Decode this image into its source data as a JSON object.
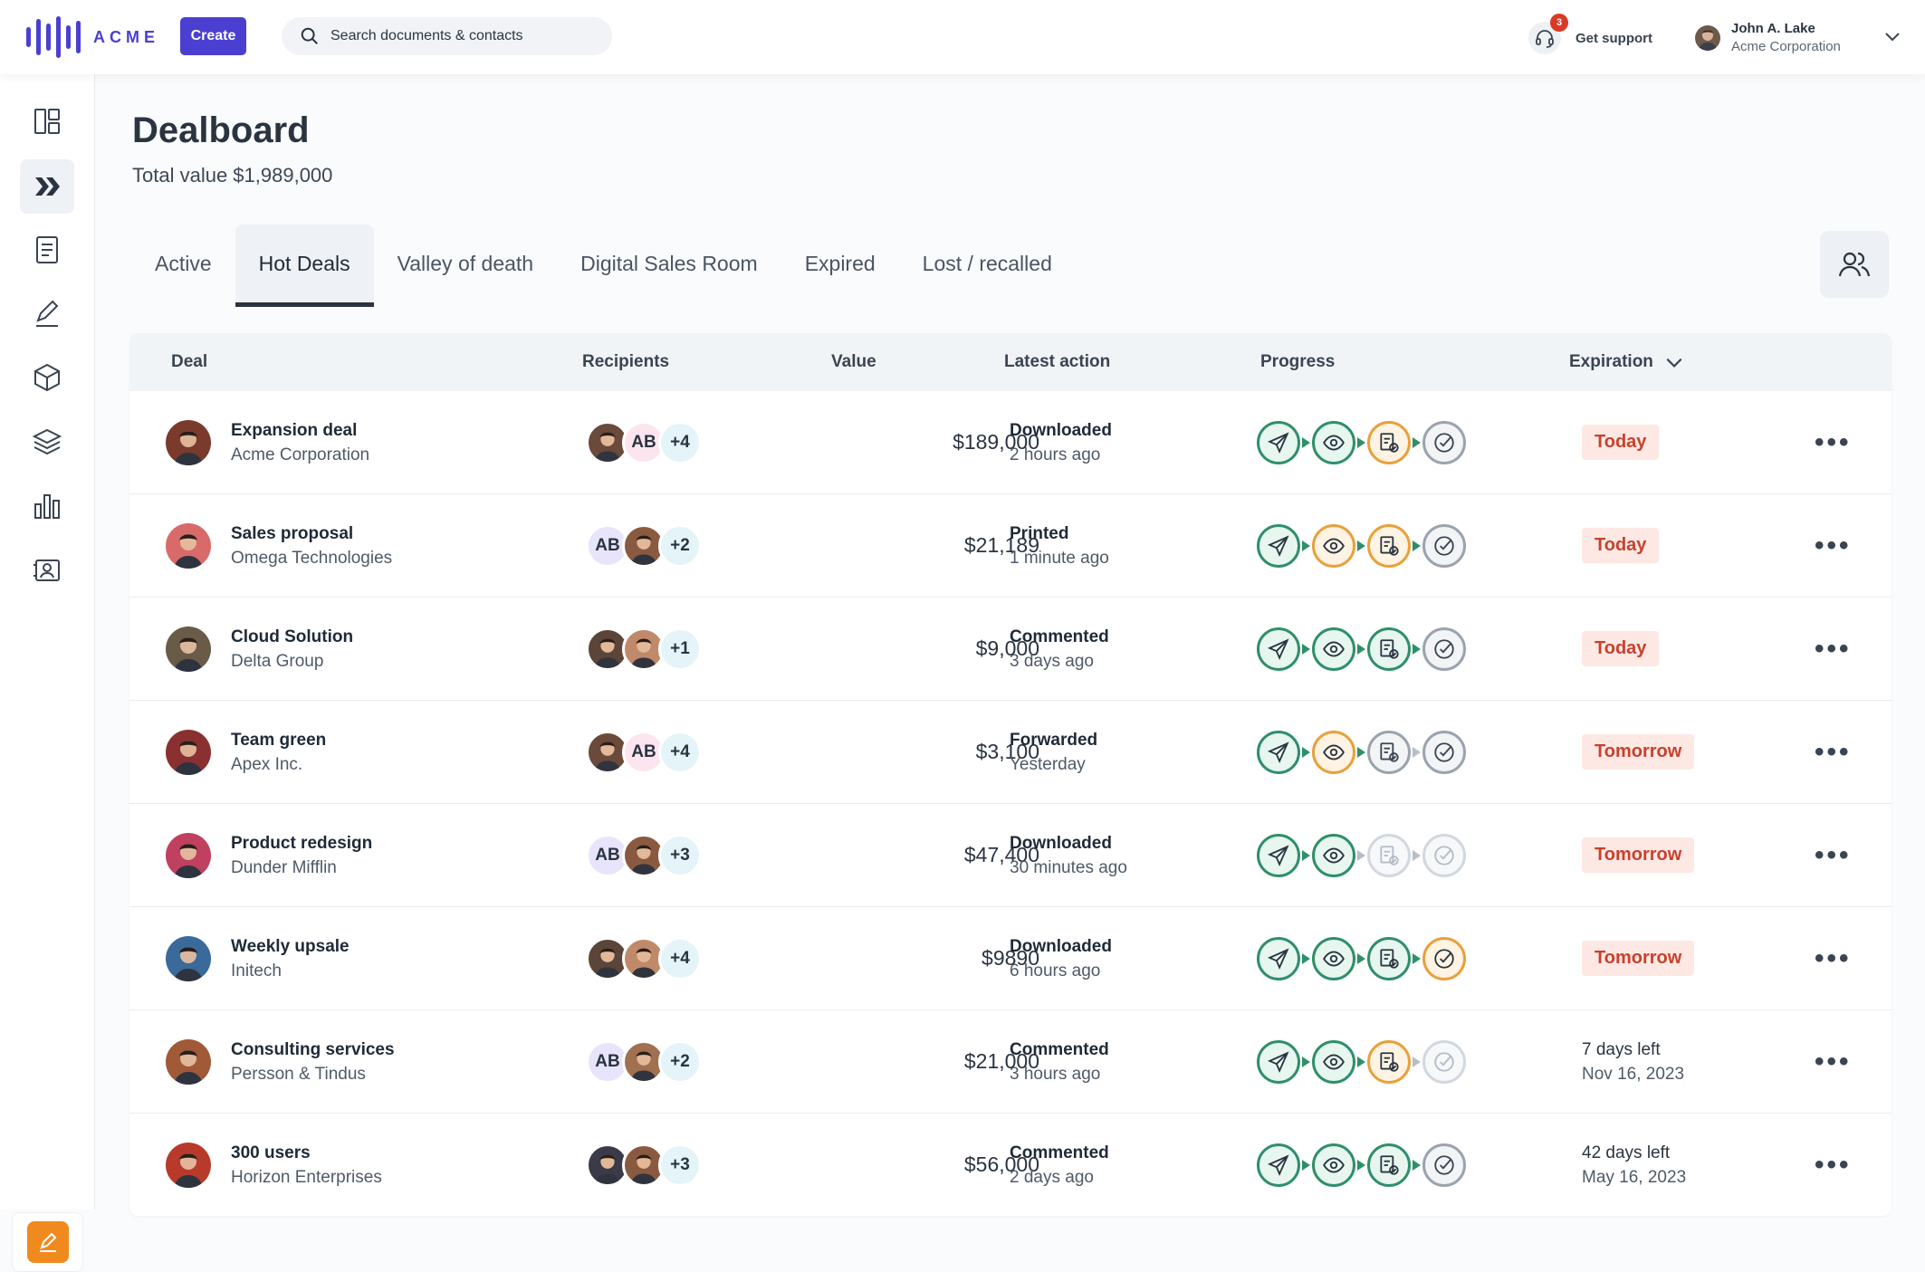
{
  "app": {
    "logo_text": "ACME",
    "create_label": "Create"
  },
  "search": {
    "placeholder": "Search documents & contacts"
  },
  "support": {
    "label": "Get support",
    "badge_count": "3"
  },
  "user": {
    "name": "John A. Lake",
    "org": "Acme Corporation"
  },
  "sidebar": {
    "items": [
      {
        "icon": "dashboard-icon"
      },
      {
        "icon": "dealboard-icon",
        "active": true
      },
      {
        "icon": "documents-icon"
      },
      {
        "icon": "signature-icon"
      },
      {
        "icon": "products-icon"
      },
      {
        "icon": "layers-icon"
      },
      {
        "icon": "analytics-icon"
      },
      {
        "icon": "contacts-icon"
      }
    ],
    "bottom_icon": "sign-pen-icon"
  },
  "page": {
    "title": "Dealboard",
    "total_value": "Total value $1,989,000"
  },
  "tabs": [
    {
      "label": "Active"
    },
    {
      "label": "Hot Deals",
      "active": true
    },
    {
      "label": "Valley of death"
    },
    {
      "label": "Digital Sales Room"
    },
    {
      "label": "Expired"
    },
    {
      "label": "Lost / recalled"
    }
  ],
  "table": {
    "headers": {
      "deal": "Deal",
      "recipients": "Recipients",
      "value": "Value",
      "latest_action": "Latest action",
      "progress": "Progress",
      "expiration": "Expiration"
    },
    "rows": [
      {
        "deal": "Expansion deal",
        "company": "Acme Corporation",
        "recipients": [
          "photo",
          "AB",
          "+4"
        ],
        "value": "$189,000",
        "action": "Downloaded",
        "action_time": "2 hours ago",
        "progress": [
          "green",
          "green",
          "orange",
          "grey"
        ],
        "expiration": "Today",
        "expiration_sub": "",
        "pill": true,
        "avatar_color": "#7a3a2c"
      },
      {
        "deal": "Sales proposal",
        "company": "Omega Technologies",
        "recipients": [
          "AB",
          "photo",
          "+2"
        ],
        "value": "$21,189",
        "action": "Printed",
        "action_time": "1 minute ago",
        "progress": [
          "green",
          "orange",
          "orange",
          "grey"
        ],
        "expiration": "Today",
        "expiration_sub": "",
        "pill": true,
        "avatar_color": "#d96a6a"
      },
      {
        "deal": "Cloud Solution",
        "company": "Delta Group",
        "recipients": [
          "photo",
          "photo",
          "+1"
        ],
        "value": "$9,000",
        "action": "Commented",
        "action_time": "3 days ago",
        "progress": [
          "green",
          "green",
          "green",
          "grey"
        ],
        "expiration": "Today",
        "expiration_sub": "",
        "pill": true,
        "avatar_color": "#6a5a48"
      },
      {
        "deal": "Team green",
        "company": "Apex Inc.",
        "recipients": [
          "photo",
          "AB",
          "+4"
        ],
        "value": "$3,100",
        "action": "Forwarded",
        "action_time": "Yesterday",
        "progress": [
          "green",
          "orange",
          "grey",
          "grey"
        ],
        "expiration": "Tomorrow",
        "expiration_sub": "",
        "pill": true,
        "avatar_color": "#8a3030"
      },
      {
        "deal": "Product redesign",
        "company": "Dunder Mifflin",
        "recipients": [
          "AB",
          "photo",
          "+3"
        ],
        "value": "$47,400",
        "action": "Downloaded",
        "action_time": "30 minutes ago",
        "progress": [
          "green",
          "green",
          "faint",
          "faint"
        ],
        "expiration": "Tomorrow",
        "expiration_sub": "",
        "pill": true,
        "avatar_color": "#c04060"
      },
      {
        "deal": "Weekly upsale",
        "company": "Initech",
        "recipients": [
          "photo",
          "photo",
          "+4"
        ],
        "value": "$9890",
        "action": "Downloaded",
        "action_time": "6 hours ago",
        "progress": [
          "green",
          "green",
          "green",
          "orange"
        ],
        "expiration": "Tomorrow",
        "expiration_sub": "",
        "pill": true,
        "avatar_color": "#3a6a9a"
      },
      {
        "deal": "Consulting services",
        "company": "Persson & Tindus",
        "recipients": [
          "AB",
          "photo",
          "+2"
        ],
        "value": "$21,000",
        "action": "Commented",
        "action_time": "3 hours ago",
        "progress": [
          "green",
          "green",
          "orange",
          "faint"
        ],
        "expiration": "7 days left",
        "expiration_sub": "Nov 16, 2023",
        "pill": false,
        "avatar_color": "#a05a38"
      },
      {
        "deal": "300 users",
        "company": "Horizon Enterprises",
        "recipients": [
          "photo",
          "photo",
          "+3"
        ],
        "value": "$56,000",
        "action": "Commented",
        "action_time": "2 days ago",
        "progress": [
          "green",
          "green",
          "green",
          "grey"
        ],
        "expiration": "42 days left",
        "expiration_sub": "May 16, 2023",
        "pill": false,
        "avatar_color": "#b83a2a"
      }
    ]
  },
  "colors": {
    "brand": "#4b3fd1",
    "progress_green": "#2f8f6b",
    "progress_orange": "#e9a03c",
    "expiry_red": "#c8412c",
    "sign_orange": "#f08a1f"
  }
}
